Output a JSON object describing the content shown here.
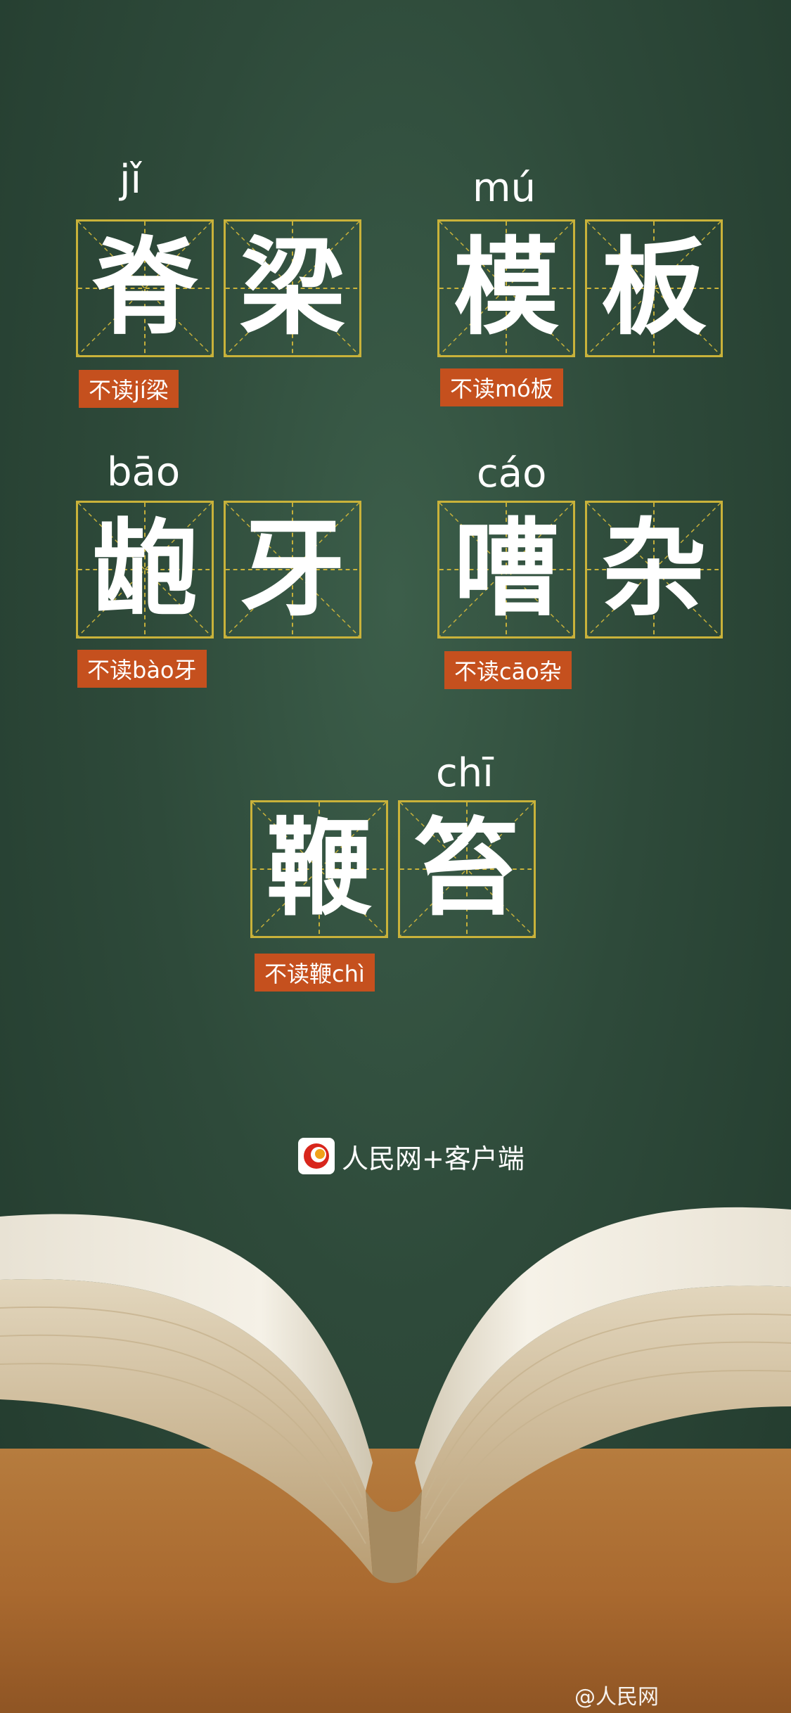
{
  "words": [
    {
      "pinyin": "jǐ",
      "chars": [
        "脊",
        "梁"
      ],
      "wrong": "不读jí梁"
    },
    {
      "pinyin": "mú",
      "chars": [
        "模",
        "板"
      ],
      "wrong": "不读mó板"
    },
    {
      "pinyin": "bāo",
      "chars": [
        "龅",
        "牙"
      ],
      "wrong": "不读bào牙"
    },
    {
      "pinyin": "cáo",
      "chars": [
        "嘈",
        "杂"
      ],
      "wrong": "不读cāo杂"
    },
    {
      "pinyin": "chī",
      "chars": [
        "鞭",
        "笞"
      ],
      "wrong": "不读鞭chì"
    }
  ],
  "logo": {
    "text": "人民网+客户端"
  },
  "credit": "@人民网",
  "colors": {
    "board": "#2f4c3b",
    "grid": "#c9b23a",
    "label": "#c5501e",
    "text": "#ffffff",
    "table": "#a9692f"
  }
}
